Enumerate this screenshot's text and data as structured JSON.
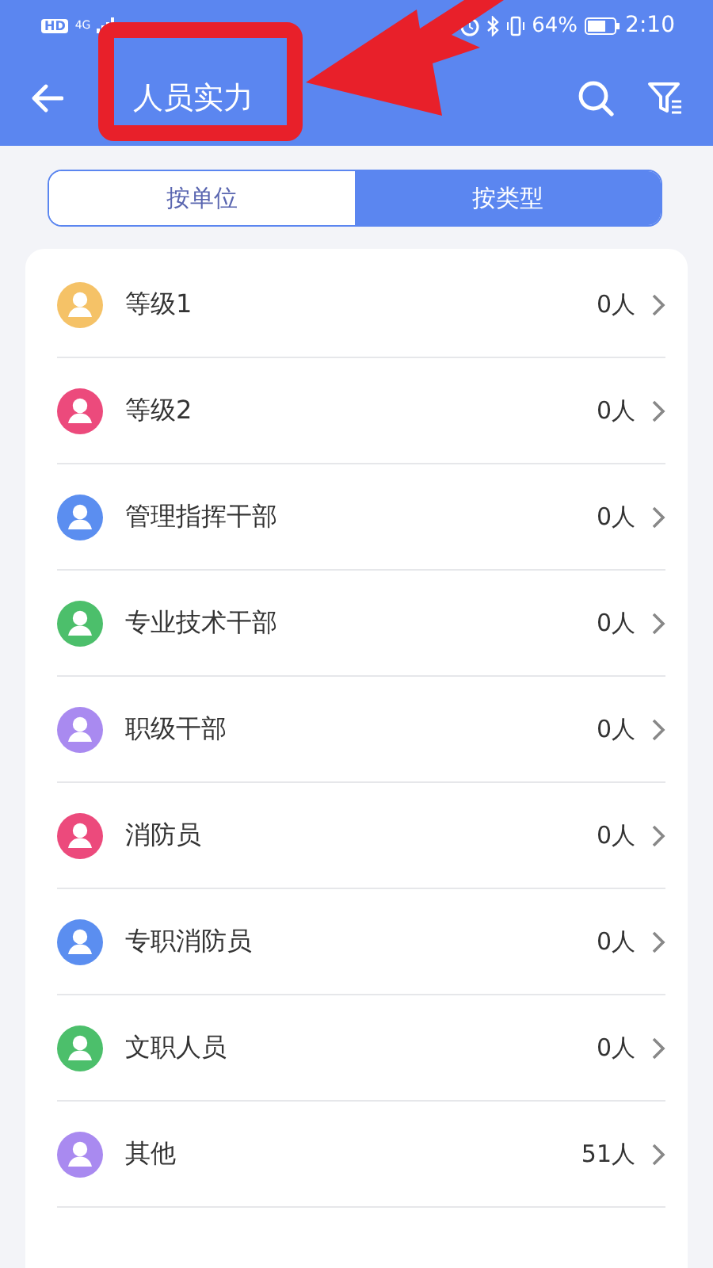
{
  "status_bar": {
    "hd": "HD",
    "network": "4G",
    "battery_percent": "64%",
    "time": "2:10"
  },
  "header": {
    "title": "人员实力"
  },
  "tabs": [
    {
      "label": "按单位",
      "selected": false
    },
    {
      "label": "按类型",
      "selected": true
    }
  ],
  "rows": [
    {
      "name": "等级1",
      "count": "0人",
      "color": "#f5c267"
    },
    {
      "name": "等级2",
      "count": "0人",
      "color": "#ec4a7c"
    },
    {
      "name": "管理指挥干部",
      "count": "0人",
      "color": "#5b8ef0"
    },
    {
      "name": "专业技术干部",
      "count": "0人",
      "color": "#4cbf6b"
    },
    {
      "name": "职级干部",
      "count": "0人",
      "color": "#a98af0"
    },
    {
      "name": "消防员",
      "count": "0人",
      "color": "#ec4a7c"
    },
    {
      "name": "专职消防员",
      "count": "0人",
      "color": "#5b8ef0"
    },
    {
      "name": "文职人员",
      "count": "0人",
      "color": "#4cbf6b"
    },
    {
      "name": "其他",
      "count": "51人",
      "color": "#a98af0"
    }
  ]
}
